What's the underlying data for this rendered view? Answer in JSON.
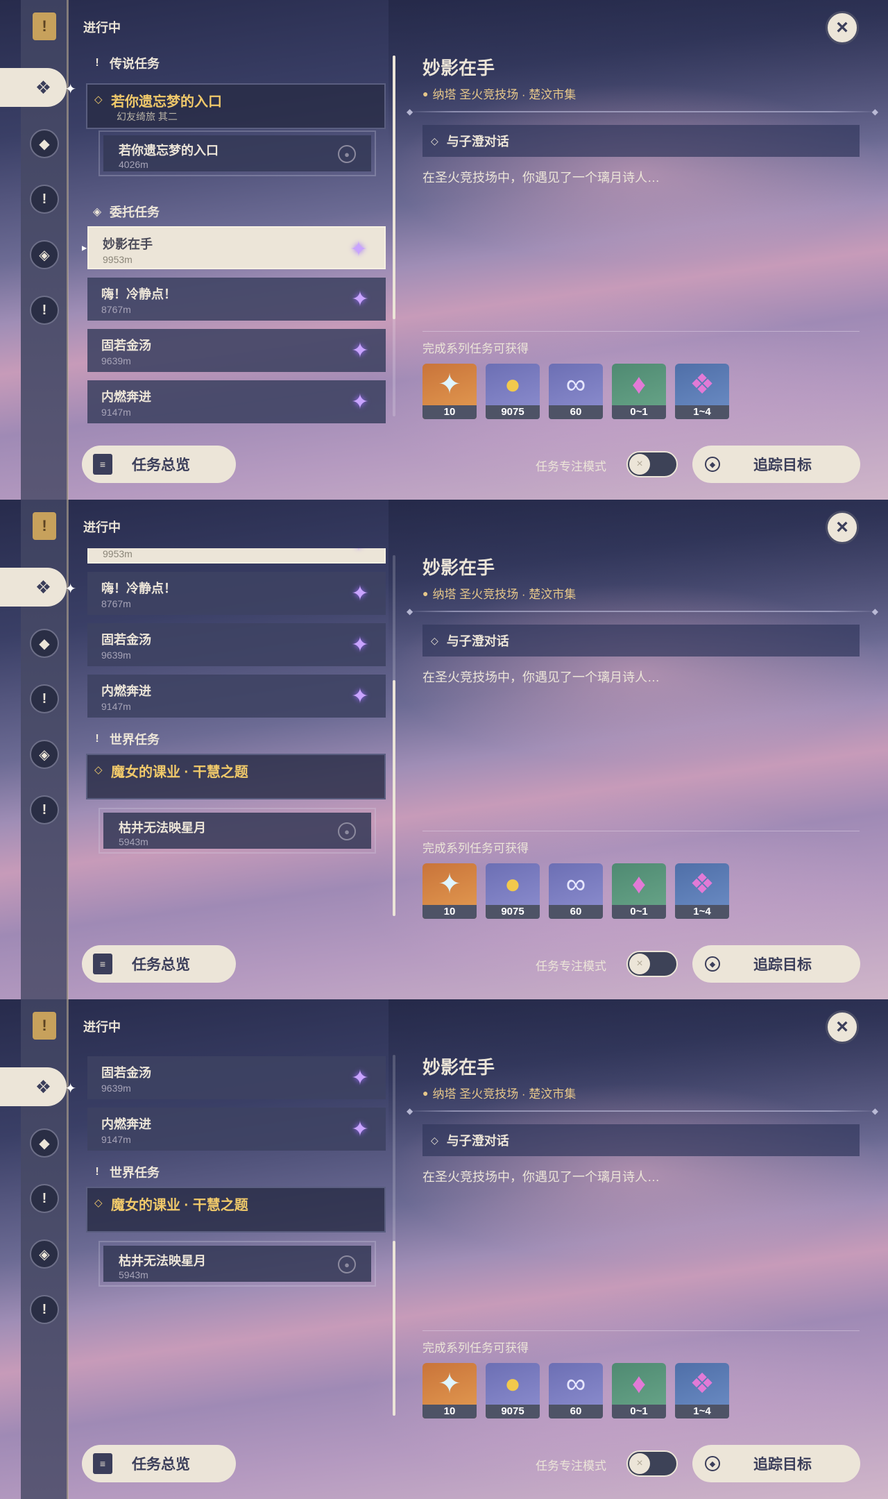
{
  "header": {
    "status": "进行中",
    "close_icon": "×"
  },
  "rail": {
    "bookmark": "!",
    "icons": [
      "◆",
      "!",
      "◈",
      "!"
    ]
  },
  "sections": {
    "legend": "传说任务",
    "commission": "委托任务",
    "world": "世界任务"
  },
  "legend_group": {
    "title": "若你遗忘梦的入口",
    "subtitle": "幻友绮旅 其二"
  },
  "legend_sub": {
    "title": "若你遗忘梦的入口",
    "dist": "4026m"
  },
  "commissions": [
    {
      "title": "妙影在手",
      "dist": "9953m"
    },
    {
      "title": "嗨！冷静点！",
      "dist": "8767m"
    },
    {
      "title": "固若金汤",
      "dist": "9639m"
    },
    {
      "title": "内燃奔进",
      "dist": "9147m"
    }
  ],
  "world_group": {
    "title": "魔女的课业 · 干慧之题"
  },
  "world_sub": {
    "title": "枯井无法映星月",
    "dist": "5943m"
  },
  "buttons": {
    "overview": "任务总览",
    "track": "追踪目标",
    "focus_mode": "任务专注模式"
  },
  "detail": {
    "title": "妙影在手",
    "location": "纳塔 圣火竞技场 · 楚汶市集",
    "objective": "与子澄对话",
    "description": "在圣火竞技场中，你遇见了一个璃月诗人…",
    "reward_label": "完成系列任务可获得"
  },
  "rewards": [
    {
      "icon": "primogem-icon",
      "count": "10"
    },
    {
      "icon": "mora-icon",
      "count": "9075"
    },
    {
      "icon": "adventure-exp-icon",
      "count": "60"
    },
    {
      "icon": "crystal-icon",
      "count": "0~1"
    },
    {
      "icon": "crystal-cluster-icon",
      "count": "1~4"
    }
  ]
}
